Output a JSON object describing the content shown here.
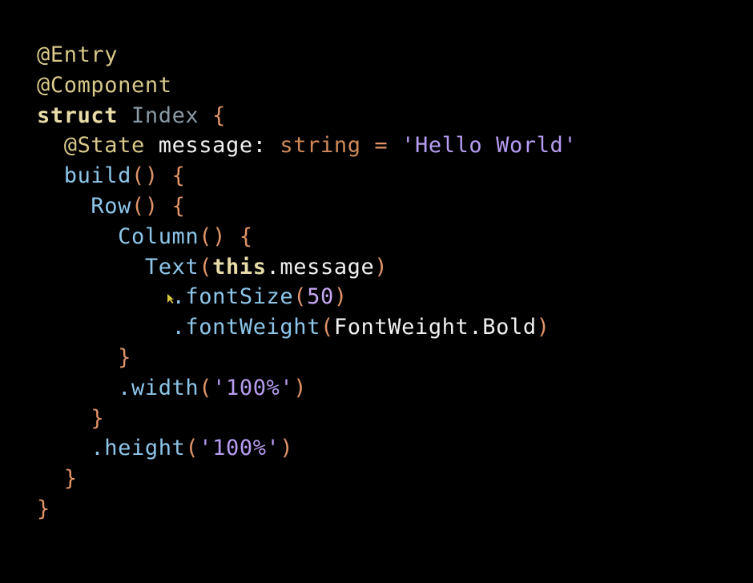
{
  "colors": {
    "background": "#000000",
    "decorator": "#d9c98a",
    "keyword": "#e8dca8",
    "type_name": "#8a9aa4",
    "brace": "#e09468",
    "property": "#f0f0f0",
    "type_keyword": "#d08a5a",
    "string": "#b69cf0",
    "function": "#8dc6ea",
    "number": "#c6a6f4"
  },
  "code_lines": [
    [
      {
        "text": "@Entry",
        "color": "decorator"
      }
    ],
    [
      {
        "text": "@Component",
        "color": "decorator"
      }
    ],
    [
      {
        "text": "struct",
        "color": "keyword",
        "bold": true
      },
      {
        "text": " ",
        "color": "property"
      },
      {
        "text": "Index",
        "color": "type_name"
      },
      {
        "text": " {",
        "color": "brace"
      }
    ],
    [
      {
        "text": "  ",
        "color": "property"
      },
      {
        "text": "@State",
        "color": "decorator"
      },
      {
        "text": " message: ",
        "color": "property"
      },
      {
        "text": "string",
        "color": "type_keyword"
      },
      {
        "text": " = ",
        "color": "brace"
      },
      {
        "text": "'Hello World'",
        "color": "string"
      }
    ],
    [
      {
        "text": "  ",
        "color": "property"
      },
      {
        "text": "build",
        "color": "function"
      },
      {
        "text": "() {",
        "color": "brace"
      }
    ],
    [
      {
        "text": "    ",
        "color": "property"
      },
      {
        "text": "Row",
        "color": "function"
      },
      {
        "text": "() {",
        "color": "brace"
      }
    ],
    [
      {
        "text": "      ",
        "color": "property"
      },
      {
        "text": "Column",
        "color": "function"
      },
      {
        "text": "() {",
        "color": "brace"
      }
    ],
    [
      {
        "text": "        ",
        "color": "property"
      },
      {
        "text": "Text",
        "color": "function"
      },
      {
        "text": "(",
        "color": "brace"
      },
      {
        "text": "this",
        "color": "keyword",
        "bold": true
      },
      {
        "text": ".message",
        "color": "property"
      },
      {
        "text": ")",
        "color": "brace"
      }
    ],
    [
      {
        "text": "          ",
        "color": "property"
      },
      {
        "text": ".fontSize",
        "color": "function"
      },
      {
        "text": "(",
        "color": "brace"
      },
      {
        "text": "50",
        "color": "number"
      },
      {
        "text": ")",
        "color": "brace"
      }
    ],
    [
      {
        "text": "          ",
        "color": "property"
      },
      {
        "text": ".fontWeight",
        "color": "function"
      },
      {
        "text": "(",
        "color": "brace"
      },
      {
        "text": "FontWeight.Bold",
        "color": "property"
      },
      {
        "text": ")",
        "color": "brace"
      }
    ],
    [
      {
        "text": "      ",
        "color": "property"
      },
      {
        "text": "}",
        "color": "brace"
      }
    ],
    [
      {
        "text": "      ",
        "color": "property"
      },
      {
        "text": ".width",
        "color": "function"
      },
      {
        "text": "(",
        "color": "brace"
      },
      {
        "text": "'100%'",
        "color": "string"
      },
      {
        "text": ")",
        "color": "brace"
      }
    ],
    [
      {
        "text": "    ",
        "color": "property"
      },
      {
        "text": "}",
        "color": "brace"
      }
    ],
    [
      {
        "text": "    ",
        "color": "property"
      },
      {
        "text": ".height",
        "color": "function"
      },
      {
        "text": "(",
        "color": "brace"
      },
      {
        "text": "'100%'",
        "color": "string"
      },
      {
        "text": ")",
        "color": "brace"
      }
    ],
    [
      {
        "text": "  ",
        "color": "property"
      },
      {
        "text": "}",
        "color": "brace"
      }
    ],
    [
      {
        "text": "}",
        "color": "brace"
      }
    ]
  ],
  "cursor": {
    "icon": "mouse-pointer-icon",
    "color": "#d8c840"
  }
}
